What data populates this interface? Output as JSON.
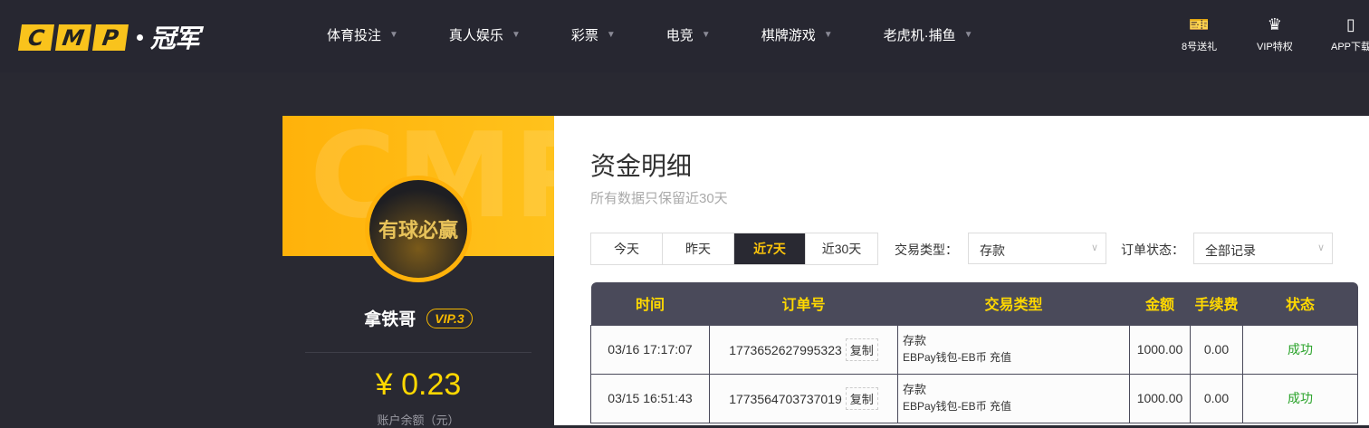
{
  "brand": {
    "letters": [
      "C",
      "M",
      "P"
    ],
    "cn": "冠军"
  },
  "nav": [
    {
      "label": "体育投注"
    },
    {
      "label": "真人娱乐"
    },
    {
      "label": "彩票"
    },
    {
      "label": "电竞"
    },
    {
      "label": "棋牌游戏"
    },
    {
      "label": "老虎机·捕鱼"
    }
  ],
  "right_links": [
    {
      "label": "8号送礼",
      "icon": "ticket-yen-icon"
    },
    {
      "label": "VIP特权",
      "icon": "crown-icon"
    },
    {
      "label": "APP下载",
      "icon": "phone-icon"
    }
  ],
  "profile": {
    "watermark": "CMP",
    "avatar_text": "有球必赢",
    "name": "拿铁哥",
    "vip": "VIP.3",
    "balance": "¥ 0.23",
    "balance_label": "账户余额（元）"
  },
  "main": {
    "title": "资金明细",
    "subtitle": "所有数据只保留近30天",
    "range_tabs": [
      {
        "label": "今天"
      },
      {
        "label": "昨天"
      },
      {
        "label": "近7天",
        "active": true
      },
      {
        "label": "近30天"
      }
    ],
    "type_label": "交易类型：",
    "type_value": "存款",
    "status_label": "订单状态：",
    "status_value": "全部记录",
    "columns": [
      "时间",
      "订单号",
      "交易类型",
      "金额",
      "手续费",
      "状态"
    ],
    "copy_label": "复制",
    "rows": [
      {
        "time": "03/16 17:17:07",
        "order": "1773652627995323",
        "type": "存款",
        "detail": "EBPay钱包-EB币 充值",
        "amount": "1000.00",
        "fee": "0.00",
        "status": "成功"
      },
      {
        "time": "03/15 16:51:43",
        "order": "1773564703737019",
        "type": "存款",
        "detail": "EBPay钱包-EB币 充值",
        "amount": "1000.00",
        "fee": "0.00",
        "status": "成功"
      }
    ]
  },
  "colors": {
    "accent": "#ffc60a",
    "header_bg": "#272731",
    "success": "#2aa32a"
  }
}
